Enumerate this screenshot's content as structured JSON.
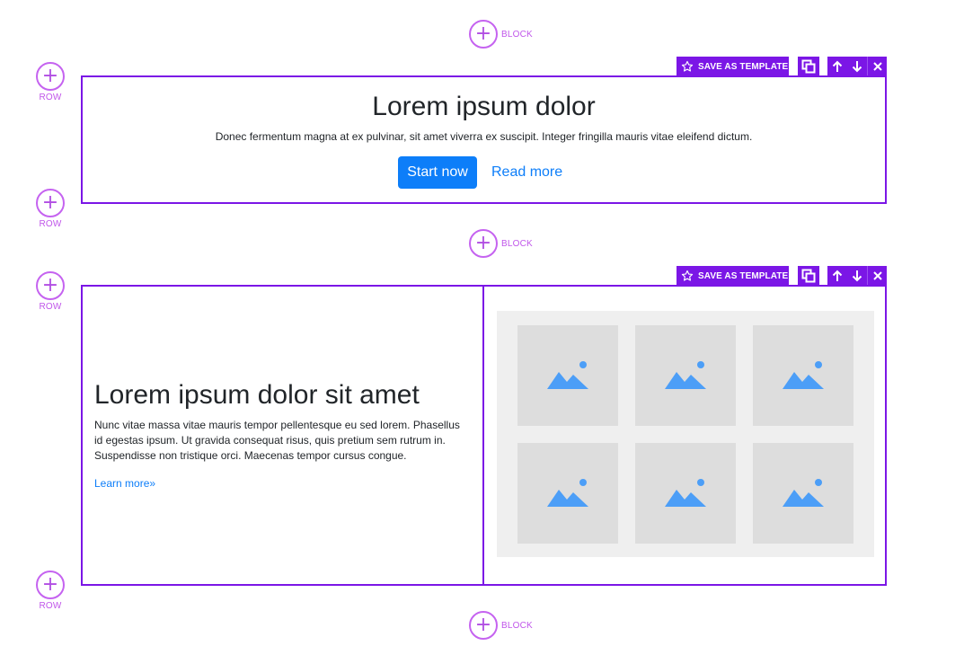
{
  "add_controls": {
    "block_label": "BLOCK",
    "row_label": "ROW",
    "plus": "+"
  },
  "toolbar": {
    "save_label": "SAVE AS TEMPLATE",
    "icons": [
      "star-icon",
      "duplicate-icon",
      "arrow-up-icon",
      "arrow-down-icon",
      "close-icon"
    ]
  },
  "hero": {
    "title": "Lorem ipsum dolor",
    "subtitle": "Donec fermentum magna at ex pulvinar, sit amet viverra ex suscipit. Integer fringilla mauris vitae eleifend dictum.",
    "primary_button": "Start now",
    "link": "Read more"
  },
  "feature": {
    "title": "Lorem ipsum dolor sit amet",
    "text": "Nunc vitae massa vitae mauris tempor pellentesque eu sed lorem. Phasellus id egestas ipsum. Ut gravida consequat risus, quis pretium sem rutrum in. Suspendisse non tristique orci. Maecenas tempor cursus congue.",
    "link": "Learn more»",
    "gallery_icon": "image-placeholder-icon"
  },
  "colors": {
    "accent": "#7b16e6",
    "add_control": "#c563f0",
    "primary": "#0d7ef9",
    "image_icon": "#4c9ef7"
  }
}
